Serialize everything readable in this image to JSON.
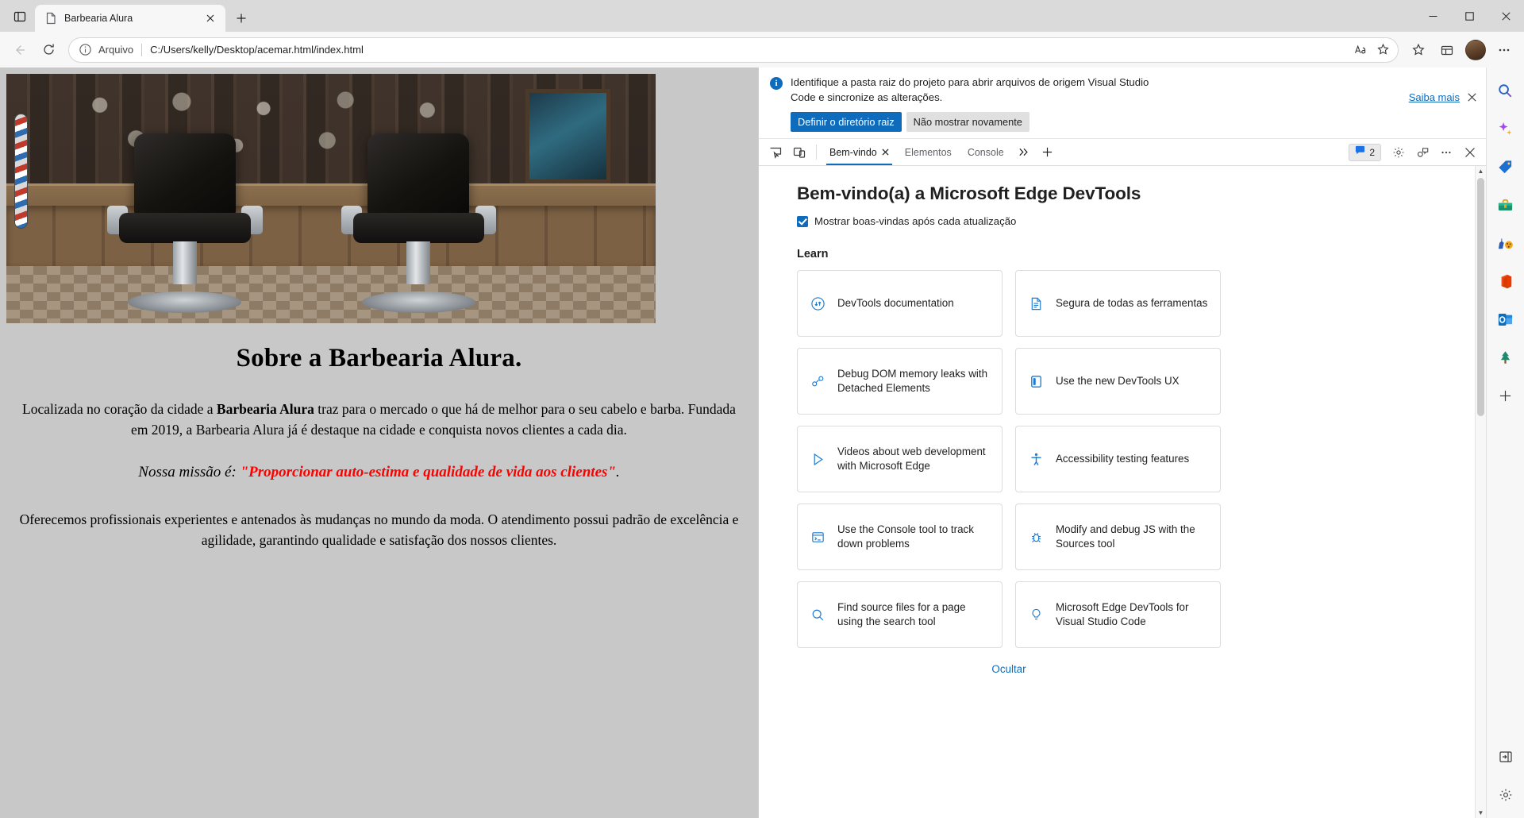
{
  "browser": {
    "tab_strip": {
      "tab_search_icon": "tab-actions-icon",
      "tabs": [
        {
          "title": "Barbearia Alura",
          "favicon": "document-icon",
          "close_label": "×",
          "active": true
        }
      ],
      "new_tab_label": "+",
      "window_controls": {
        "minimize": "─",
        "maximize": "☐",
        "close": "✕"
      }
    },
    "navbar": {
      "back_icon": "back-arrow-icon",
      "reload_icon": "reload-icon",
      "omnibox": {
        "info_icon": "info-circle-icon",
        "scheme_label": "Arquivo",
        "url": "C:/Users/kelly/Desktop/acemar.html/index.html"
      },
      "actions": [
        {
          "name": "read-aloud-icon",
          "glyph": "Aᴺ"
        },
        {
          "name": "add-favorite-icon",
          "glyph": "☆"
        },
        {
          "name": "favorites-icon",
          "glyph": "☆"
        },
        {
          "name": "collections-icon",
          "glyph": "▦"
        },
        {
          "name": "profile-avatar",
          "glyph": ""
        },
        {
          "name": "settings-more-icon",
          "glyph": "⋯"
        }
      ]
    }
  },
  "webpage": {
    "hero_image_alt": "barbershop-interior-photo",
    "heading": "Sobre a Barbearia Alura.",
    "paragraph_1": {
      "before": "Localizada no coração da cidade a ",
      "bold": "Barbearia Alura",
      "after": " traz para o mercado o que há de melhor para o seu cabelo e barba. Fundada em 2019, a Barbearia Alura já é destaque na cidade e conquista novos clientes a cada dia."
    },
    "mission": {
      "prefix": "Nossa missão é: ",
      "quote": "\"Proporcionar auto-estima e qualidade de vida aos clientes\"",
      "suffix": "."
    },
    "paragraph_2": "Oferecemos profissionais experientes e antenados às mudanças no mundo da moda. O atendimento possui padrão de excelência e agilidade, garantindo qualidade e satisfação dos nossos clientes."
  },
  "devtools": {
    "notice": {
      "icon": "info-icon",
      "text": "Identifique a pasta raiz do projeto para abrir arquivos de origem Visual Studio Code e sincronize as alterações.",
      "primary_button": "Definir o diretório raiz",
      "secondary_button": "Não mostrar novamente",
      "link": "Saiba mais",
      "close_icon": "close-icon"
    },
    "toolbar": {
      "inspect_icon": "inspect-element-icon",
      "device_toggle_icon": "device-emulation-icon",
      "tabs": [
        {
          "label": "Bem-vindo",
          "active": true,
          "closable": true
        },
        {
          "label": "Elementos",
          "active": false,
          "closable": false
        },
        {
          "label": "Console",
          "active": false,
          "closable": false
        }
      ],
      "more_tabs_icon": "chevron-double-right-icon",
      "add_tab_icon": "plus-icon",
      "issues_count": "2",
      "issues_icon": "issues-message-icon",
      "settings_icon": "gear-icon",
      "feedback_icon": "feedback-icon",
      "more_options_icon": "ellipsis-icon",
      "close_icon": "close-icon"
    },
    "welcome": {
      "title": "Bem-vindo(a) a Microsoft Edge DevTools",
      "checkbox_label": "Mostrar boas-vindas após cada atualização",
      "checkbox_checked": true,
      "learn_heading": "Learn",
      "cards": [
        {
          "label": "DevTools documentation",
          "icon": "download-circle-icon"
        },
        {
          "label": "Segura de todas as ferramentas",
          "icon": "document-list-icon"
        },
        {
          "label": "Debug DOM memory leaks with Detached Elements",
          "icon": "detached-elements-icon"
        },
        {
          "label": "Use the new DevTools UX",
          "icon": "layout-panel-icon"
        },
        {
          "label": "Videos about web development with Microsoft Edge",
          "icon": "play-triangle-icon"
        },
        {
          "label": "Accessibility testing features",
          "icon": "accessibility-person-icon"
        },
        {
          "label": "Use the Console tool to track down problems",
          "icon": "console-terminal-icon"
        },
        {
          "label": "Modify and debug JS with the Sources tool",
          "icon": "bug-icon"
        },
        {
          "label": "Find source files for a page using the search tool",
          "icon": "search-icon"
        },
        {
          "label": "Microsoft Edge DevTools for Visual Studio Code",
          "icon": "lightbulb-icon"
        }
      ],
      "hide_link": "Ocultar"
    }
  },
  "edge_sidebar": {
    "icons": [
      {
        "name": "search-icon"
      },
      {
        "name": "copilot-sparkle-icon"
      },
      {
        "name": "shopping-tag-icon"
      },
      {
        "name": "tools-toolbox-icon"
      },
      {
        "name": "games-icon"
      },
      {
        "name": "office-icon"
      },
      {
        "name": "outlook-icon"
      },
      {
        "name": "tree-icon"
      },
      {
        "name": "add-sidebar-icon"
      }
    ],
    "bottom_icons": [
      {
        "name": "expand-sidebar-icon"
      },
      {
        "name": "sidebar-settings-icon"
      }
    ]
  },
  "colors": {
    "accent": "#0f6cbd",
    "link": "#0f6cbd",
    "mission_red": "#ff0000",
    "page_bg": "#c8c8c8",
    "chrome_bg": "#f7f7f7"
  }
}
